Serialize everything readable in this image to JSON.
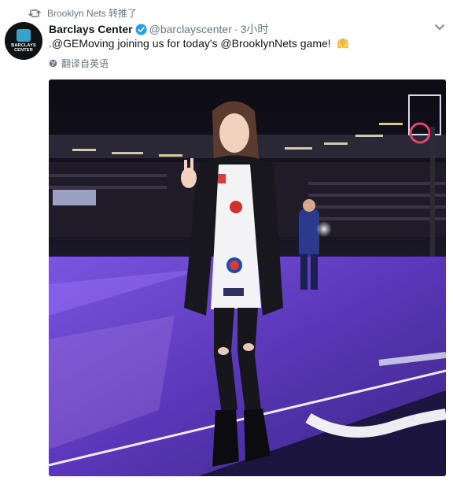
{
  "retweet": {
    "label": "Brooklyn Nets 转推了"
  },
  "tweet": {
    "display_name": "Barclays Center",
    "handle": "@barclayscenter",
    "separator": "·",
    "time": "3小时",
    "text": ".@GEMoving joining us for today's @BrooklynNets game!",
    "translate_label": "翻译自英语"
  },
  "avatar": {
    "logo_text": "BARCLAYS CENTER"
  },
  "icons": {
    "retweet": "retweet-icon",
    "verified": "verified-badge-icon",
    "caret": "chevron-down-icon",
    "globe": "globe-icon",
    "emoji": "raised-hands-emoji"
  },
  "colors": {
    "verified": "#1da1f2",
    "muted": "#657786",
    "text": "#14171a",
    "court_purple": "#5a37b8"
  }
}
